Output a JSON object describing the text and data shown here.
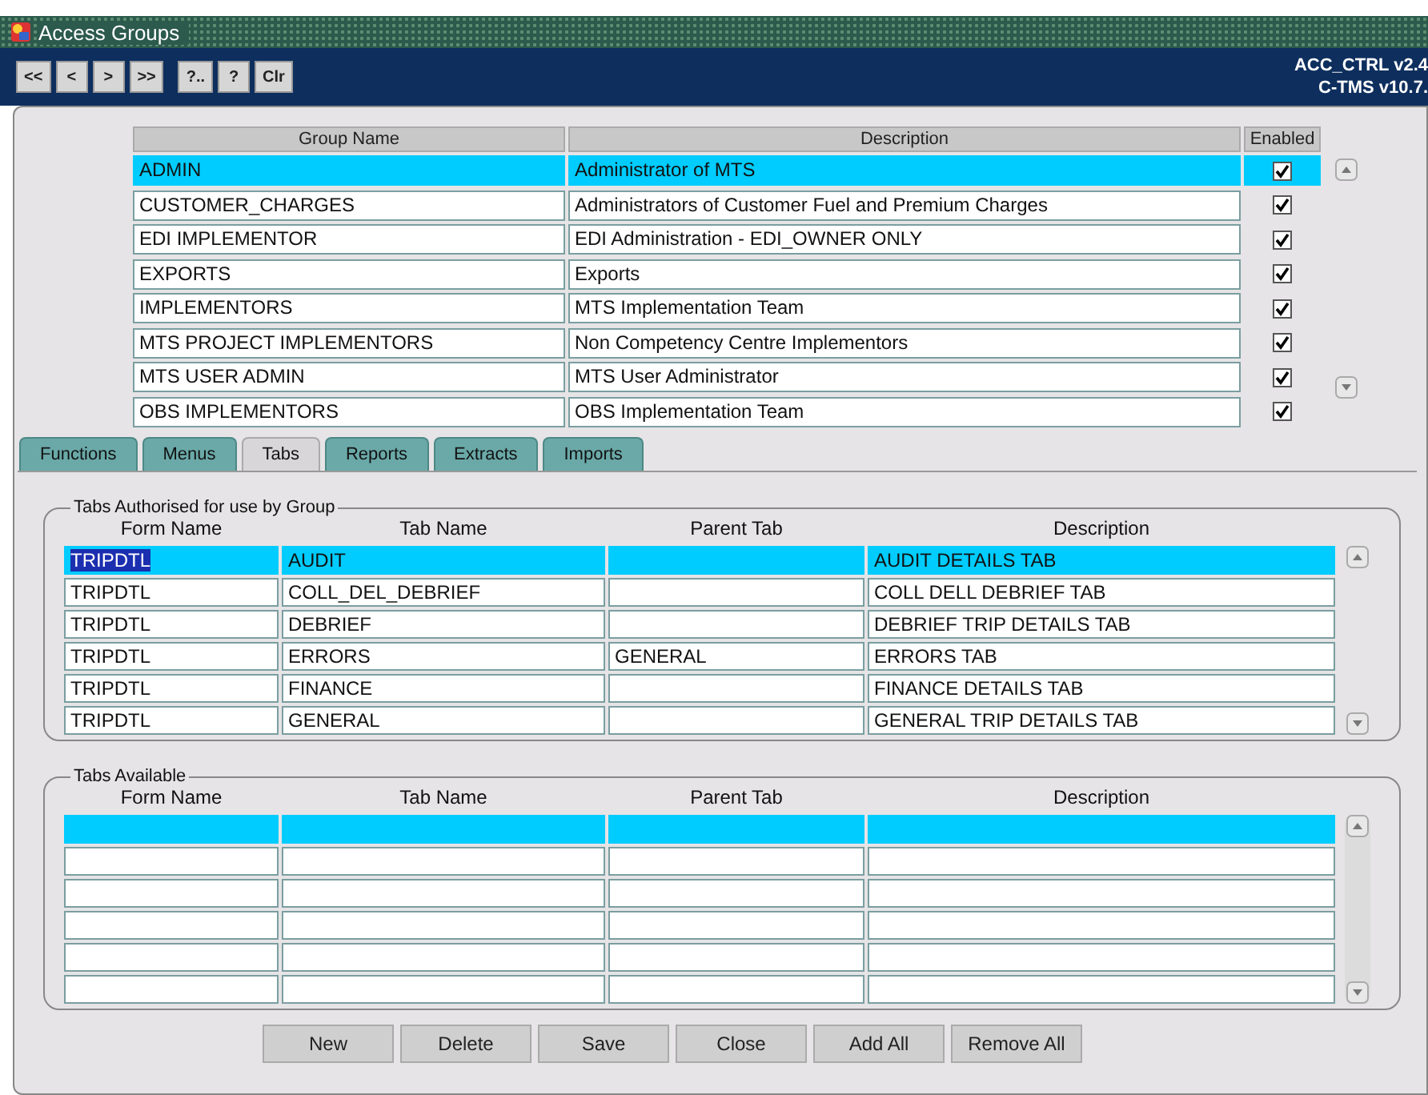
{
  "window": {
    "title": "Access Groups"
  },
  "toolbar": {
    "buttons": [
      "<<",
      "<",
      ">",
      ">>",
      "?..",
      "?",
      "Clr"
    ],
    "version_lines": [
      "ACC_CTRL v2.4",
      "C-TMS v10.7."
    ]
  },
  "groups": {
    "columns": [
      "Group Name",
      "Description",
      "Enabled"
    ],
    "rows": [
      {
        "name": "ADMIN",
        "description": "Administrator of MTS",
        "enabled": true,
        "selected": true
      },
      {
        "name": "CUSTOMER_CHARGES",
        "description": "Administrators of Customer Fuel and Premium Charges",
        "enabled": true,
        "selected": false
      },
      {
        "name": "EDI IMPLEMENTOR",
        "description": "EDI Administration - EDI_OWNER ONLY",
        "enabled": true,
        "selected": false
      },
      {
        "name": "EXPORTS",
        "description": "Exports",
        "enabled": true,
        "selected": false
      },
      {
        "name": "IMPLEMENTORS",
        "description": "MTS Implementation Team",
        "enabled": true,
        "selected": false
      },
      {
        "name": "MTS PROJECT IMPLEMENTORS",
        "description": "Non Competency Centre Implementors",
        "enabled": true,
        "selected": false
      },
      {
        "name": "MTS USER ADMIN",
        "description": "MTS User Administrator",
        "enabled": true,
        "selected": false
      },
      {
        "name": "OBS IMPLEMENTORS",
        "description": "OBS Implementation Team",
        "enabled": true,
        "selected": false
      }
    ]
  },
  "tabs": [
    {
      "label": "Functions",
      "selected": false
    },
    {
      "label": "Menus",
      "selected": false
    },
    {
      "label": "Tabs",
      "selected": true
    },
    {
      "label": "Reports",
      "selected": false
    },
    {
      "label": "Extracts",
      "selected": false
    },
    {
      "label": "Imports",
      "selected": false
    }
  ],
  "authorised": {
    "title": "Tabs Authorised for use by Group",
    "columns": [
      "Form Name",
      "Tab Name",
      "Parent Tab",
      "Description"
    ],
    "rows": [
      {
        "form_name": "TRIPDTL",
        "tab_name": "AUDIT",
        "description": "AUDIT DETAILS TAB",
        "selected": true,
        "text_highlighted": true
      },
      {
        "form_name": "TRIPDTL",
        "tab_name": "COLL_DEL_DEBRIEF",
        "description": "COLL DELL DEBRIEF TAB",
        "selected": false,
        "text_highlighted": false
      },
      {
        "form_name": "TRIPDTL",
        "tab_name": "DEBRIEF",
        "description": "DEBRIEF TRIP DETAILS TAB",
        "selected": false,
        "text_highlighted": false
      },
      {
        "form_name": "TRIPDTL",
        "tab_name": "ERRORS",
        "parent_tab": "GENERAL",
        "description": "ERRORS TAB",
        "selected": false,
        "text_highlighted": false
      },
      {
        "form_name": "TRIPDTL",
        "tab_name": "FINANCE",
        "description": "FINANCE DETAILS TAB",
        "selected": false,
        "text_highlighted": false
      },
      {
        "form_name": "TRIPDTL",
        "tab_name": "GENERAL",
        "description": "GENERAL TRIP DETAILS TAB",
        "selected": false,
        "text_highlighted": false
      }
    ]
  },
  "available": {
    "title": "Tabs Available",
    "columns": [
      "Form Name",
      "Tab Name",
      "Parent Tab",
      "Description"
    ],
    "rows": [
      {
        "selected": true
      },
      {
        "selected": false
      },
      {
        "selected": false
      },
      {
        "selected": false
      },
      {
        "selected": false
      },
      {
        "selected": false
      }
    ]
  },
  "buttons": [
    "New",
    "Delete",
    "Save",
    "Close",
    "Add All",
    "Remove All"
  ]
}
